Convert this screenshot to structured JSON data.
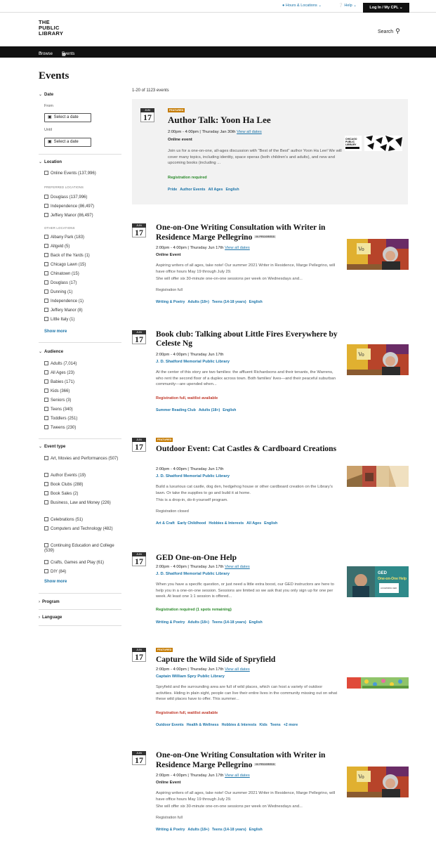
{
  "util": {
    "hours": "Hours & Locations",
    "help": "Help",
    "login": "Log In / My CPL"
  },
  "logo": [
    "THE",
    "PUBLIC",
    "LIBRARY"
  ],
  "search_label": "Search",
  "nav": {
    "browse": "Browse",
    "events": "Events"
  },
  "page_title": "Events",
  "results_count": "1-20 of 1123 events",
  "filters": {
    "date": {
      "title": "Date",
      "from": "From",
      "until": "Until",
      "select": "Select a date"
    },
    "location": {
      "title": "Location",
      "online": "Online Events (137,996)",
      "preferred_label": "PREFERRED LOCATIONS",
      "preferred": [
        "Douglass (137,996)",
        "Independence (86,497)",
        "Jeffery Manor (86,497)"
      ],
      "other_label": "OTHER LOCATIONS",
      "other": [
        "Albany Park (183)",
        "Altgeld (5)",
        "Back of the Yards (1)",
        "Chicago Lawn (15)",
        "Chinatown (15)",
        "Douglass (17)",
        "Dunning (1)",
        "Independence (1)",
        "Jeffery Manor (8)",
        "Little Italy (1)"
      ],
      "show_more": "Show more"
    },
    "audience": {
      "title": "Audience",
      "items": [
        "Adults (7,014)",
        "All Ages (23)",
        "Babies (171)",
        "Kids (366)",
        "Seniors (3)",
        "Teens (340)",
        "Toddlers (251)",
        "Tweens (230)"
      ]
    },
    "event_type": {
      "title": "Event type",
      "items": [
        "Art, Movies and Performances (507)",
        "Author Events (19)",
        "Book Clubs (288)",
        "Book Sales (2)",
        "Business, Law and Money (226)",
        "Celebrations (51)",
        "Computers and Technology (482)",
        "Continuing Education and College (539)",
        "Crafts, Games and Play (61)",
        "DIY (84)"
      ],
      "show_more": "Show more"
    },
    "program": "Program",
    "language": "Language"
  },
  "events": [
    {
      "month": "JUN",
      "day": "17",
      "featured": "FEATURED",
      "title": "Author Talk: Yoon Ha Lee",
      "status": "",
      "time": "2:00pm - 4:00pm | Thursday Jan 30th",
      "view_all": "View all dates",
      "location": "Online event",
      "desc": "Join us for a one-on-one, all-ages discussion with “Best of the Best” author Yoon Ha Lee! We will cover many topics, including identity, space operas (both children’s and adults), and new and upcoming books (including ...",
      "desc2": "",
      "registration": "Registration required",
      "tags": [
        "Pride",
        "Author Events",
        "All Ages",
        "English"
      ]
    },
    {
      "month": "JUN",
      "day": "17",
      "featured": "",
      "title": "One-on-One Writing Consultation with Writer in Residence Marge Pellegrino",
      "status": "IN PROGRESS",
      "time": "2:00pm - 4:00pm | Thursday Jun 17th",
      "view_all": "View all dates",
      "location": "Online Event",
      "desc": "Aspiring writers of all ages, take note! Our summer 2021 Writer in Residence, Marge Pellegrino, will have office hours May 19 through July 29.",
      "desc2": "She will offer six 30-minute one-on-one sessions per week on Wednesdays and...",
      "registration": "Registration full",
      "tags": [
        "Writing & Poetry",
        "Adults (18+)",
        "Teens (14-18 years)",
        "English"
      ]
    },
    {
      "month": "JUN",
      "day": "17",
      "featured": "",
      "title": "Book club: Talking about Little Fires Everywhere by Celeste Ng",
      "status": "",
      "time": "2:00pm - 4:00pm | Thursday Jun 17th",
      "view_all": "",
      "location": "J. D. Shatford Memorial Public Library",
      "desc": "At the center of this story are two families: the affluent Richardsons and their tenants, the Warrens, who rent the second floor of a duplex across town. Both families’ lives—and their peaceful suburban community—are upended when...",
      "desc2": "",
      "registration": "Registration full, waitlist available",
      "tags": [
        "Summer Reading Club",
        "Adults (18+)",
        "English"
      ]
    },
    {
      "month": "JUN",
      "day": "17",
      "featured": "FEATURED",
      "title": "Outdoor Event: Cat Castles & Cardboard Creations",
      "status": "",
      "time": "2:00pm - 4:00pm | Thursday Jun 17th",
      "view_all": "",
      "location": "J. D. Shatford Memorial Public Library",
      "desc": "Build a luxurious cat castle, dog den, hedgehog house or other cardboard creation on the Library’s lawn. Or take the supplies to go and build it at home.",
      "desc2": "This is a drop-in, do-it-yourself program.",
      "registration": "Registration closed",
      "tags": [
        "Art & Craft",
        "Early Childhood",
        "Hobbies & Interests",
        "All Ages",
        "English"
      ]
    },
    {
      "month": "JUN",
      "day": "17",
      "featured": "",
      "title": "GED One-on-One Help",
      "status": "",
      "time": "2:00pm - 4:00pm | Thursday Jun 17th",
      "view_all": "View all dates",
      "location": "J. D. Shatford Memorial Public Library",
      "desc": "When you have a specific question, or just need a little extra boost, our GED instructors are here to help you in a one-on-one session. Sessions are limited so we ask that you only sign up for one per week. At least one 1:1 session is offered...",
      "desc2": "",
      "registration": "Registration required (1 spots remaining)",
      "tags": [
        "Writing & Poetry",
        "Adults (18+)",
        "Teens (14-18 years)",
        "English"
      ]
    },
    {
      "month": "JUN",
      "day": "17",
      "featured": "FEATURED",
      "title": "Capture the Wild Side of Spryfield",
      "status": "",
      "time": "2:00pm - 4:00pm | Thursday Jun 17th",
      "view_all": "View all dates",
      "location": "Captain William Spry Public Library",
      "desc": "Spryfield and the surrounding area are full of wild places, which can host a variety of outdoor activities. Hiding in plain sight, people can live their entire lives in the community missing out on what these wild places have to offer. This summer...",
      "desc2": "",
      "registration": "Registration full, waitlist available",
      "tags": [
        "Outdoor Events",
        "Health & Wellness",
        "Hobbies & Interests",
        "Kids",
        "Teens",
        "+2 more"
      ]
    },
    {
      "month": "JUN",
      "day": "17",
      "featured": "",
      "title": "One-on-One Writing Consultation with Writer in Residence Marge Pellegrino",
      "status": "IN PROGRESS",
      "time": "2:00pm - 4:00pm | Thursday Jun 17th",
      "view_all": "View all dates",
      "location": "Online Event",
      "desc": "Aspiring writers of all ages, take note! Our summer 2021 Writer in Residence, Marge Pellegrino, will have office hours May 19 through July 29.",
      "desc2": "She will offer six 30-minute one-on-one sessions per week on Wednesdays and...",
      "registration": "Registration full",
      "tags": [
        "Writing & Poetry",
        "Adults (18+)",
        "Teens (14-18 years)",
        "English"
      ]
    }
  ],
  "thumbs": {
    "chicago_logo": [
      "CHICAGO",
      "PUBLIC",
      "LIBRARY"
    ],
    "ged_line1": "GED",
    "ged_line2": "One-on-One Help",
    "ged_badge": "ACCESSING GED",
    "spryfield_label": ""
  },
  "colors": {
    "link": "#1a73a8",
    "featured": "#c47a00",
    "nav": "#111111",
    "registration_ok": "#2a8a2a",
    "registration_full": "#c0392b"
  }
}
